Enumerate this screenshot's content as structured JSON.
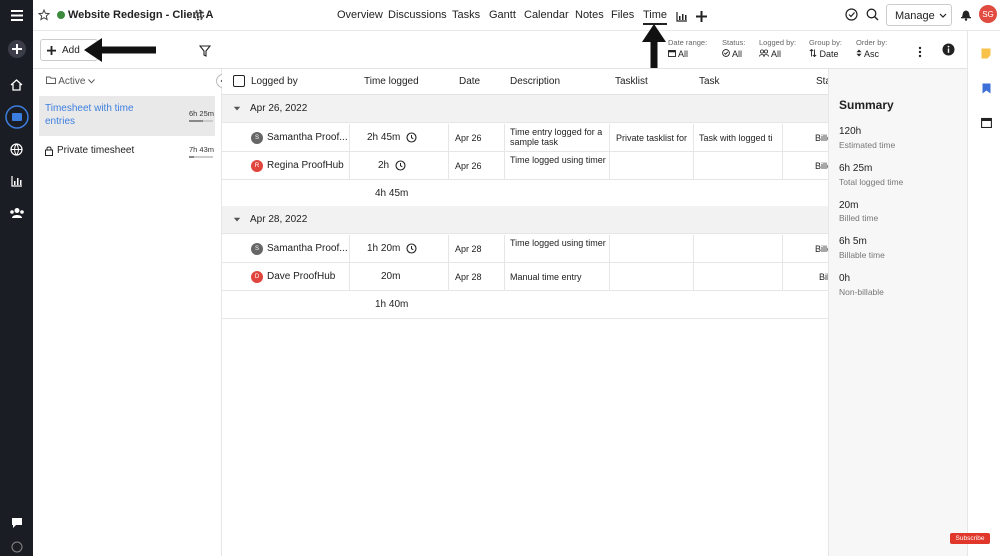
{
  "topbar": {
    "project_name": "Website Redesign - Client A",
    "status_color": "#3c8a3c",
    "nav": [
      "Overview",
      "Discussions",
      "Tasks",
      "Gantt",
      "Calendar",
      "Notes",
      "Files",
      "Time"
    ],
    "manage_label": "Manage",
    "avatar_initials": "SG",
    "avatar_color": "#e04a3f"
  },
  "toolbar": {
    "add_label": "Add",
    "filters": [
      {
        "label": "Date range:",
        "value": "All"
      },
      {
        "label": "Status:",
        "value": "All"
      },
      {
        "label": "Logged by:",
        "value": "All"
      },
      {
        "label": "Group by:",
        "value": "Date"
      },
      {
        "label": "Order by:",
        "value": "Asc"
      }
    ]
  },
  "left_panel": {
    "filter_label": "Active",
    "timesheets": [
      {
        "name": "Timesheet with time entries",
        "time": "6h 25m",
        "progress": 0.6
      },
      {
        "name": "Private timesheet",
        "time": "7h 43m",
        "progress": 0.2
      }
    ]
  },
  "grid": {
    "columns": [
      "Logged by",
      "Time logged",
      "Date",
      "Description",
      "Tasklist",
      "Task",
      "Status"
    ],
    "groups": [
      {
        "date": "Apr 26, 2022",
        "total": "4h 45m",
        "rows": [
          {
            "initial": "S",
            "avatar_color": "#666666",
            "user": "Samantha Proof...",
            "time": "2h 45m",
            "date": "Apr 26",
            "desc": "Time entry logged for a sample task",
            "tasklist": "Private tasklist for",
            "task": "Task with logged ti",
            "status": "Billed"
          },
          {
            "initial": "R",
            "avatar_color": "#e0453d",
            "user": "Regina ProofHub",
            "time": "2h",
            "date": "Apr 26",
            "desc": "Time logged using timer",
            "tasklist": "",
            "task": "",
            "status": "Billed"
          }
        ]
      },
      {
        "date": "Apr 28, 2022",
        "total": "1h 40m",
        "rows": [
          {
            "initial": "S",
            "avatar_color": "#666666",
            "user": "Samantha Proof...",
            "time": "1h 20m",
            "date": "Apr 28",
            "desc": "Time logged using timer",
            "tasklist": "",
            "task": "",
            "status": "Billed"
          },
          {
            "initial": "D",
            "avatar_color": "#e0453d",
            "user": "Dave ProofHub",
            "time": "20m",
            "date": "Apr 28",
            "desc": "Manual time entry",
            "tasklist": "",
            "task": "",
            "status": "Billable"
          }
        ]
      }
    ]
  },
  "summary": {
    "title": "Summary",
    "items": [
      {
        "value": "120h",
        "label": "Estimated time"
      },
      {
        "value": "6h 25m",
        "label": "Total logged time"
      },
      {
        "value": "20m",
        "label": "Billed time"
      },
      {
        "value": "6h 5m",
        "label": "Billable time"
      },
      {
        "value": "0h",
        "label": "Non-billable"
      }
    ]
  },
  "badge": {
    "label": "Subscribe",
    "color": "#e1372b"
  }
}
